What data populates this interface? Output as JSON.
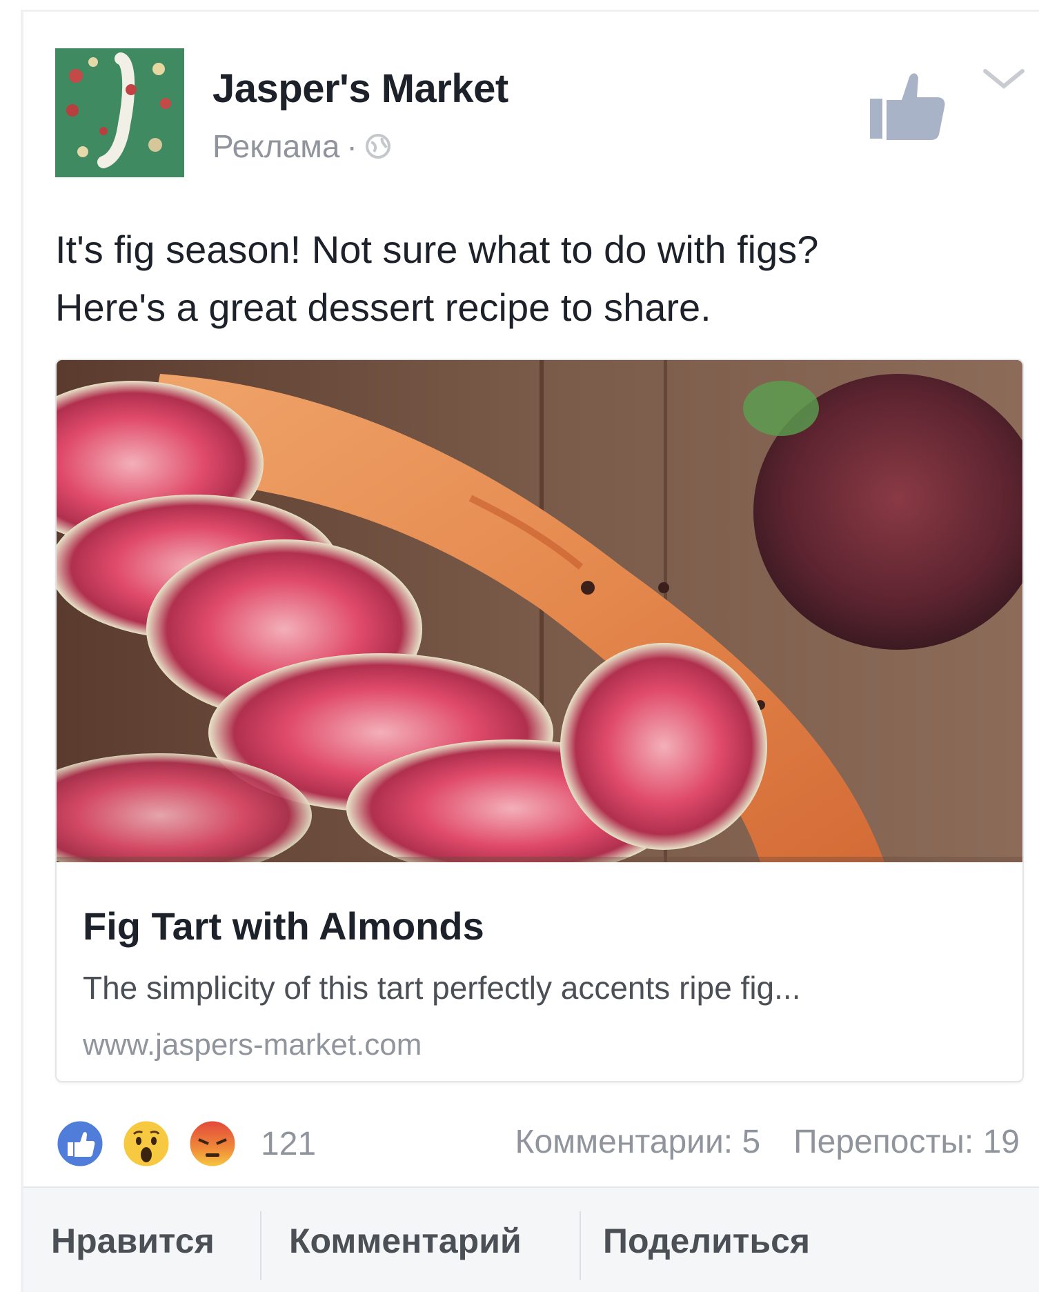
{
  "post": {
    "page_name": "Jasper's Market",
    "sponsored_label": "Реклама",
    "separator": "·",
    "message_line1": "It's fig season! Not sure what to do with figs?",
    "message_line2": "Here's a great dessert recipe to share."
  },
  "link": {
    "title": "Fig Tart with Almonds",
    "description": "The simplicity of this tart perfectly accents ripe fig...",
    "domain": "www.jaspers-market.com"
  },
  "reactions": {
    "icons": [
      "like-reaction-icon",
      "wow-reaction-icon",
      "angry-reaction-icon"
    ],
    "count": "121",
    "comments": "Комментарии: 5",
    "shares": "Перепосты: 19"
  },
  "actions": {
    "like": "Нравится",
    "comment": "Комментарий",
    "share": "Поделиться"
  },
  "colors": {
    "text_primary": "#1d2129",
    "text_secondary": "#90949c",
    "like_blue": "#4f7dd9",
    "action_bar_bg": "#f5f6f7"
  }
}
